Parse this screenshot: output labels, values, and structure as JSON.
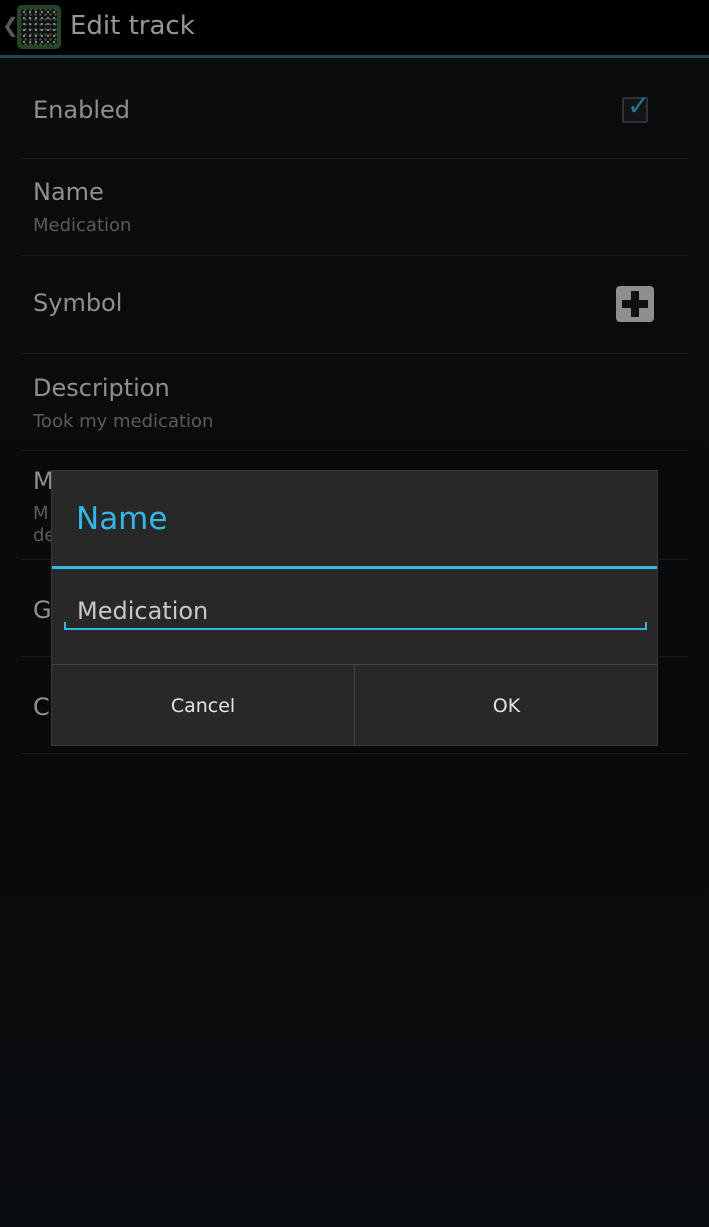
{
  "action_bar": {
    "title": "Edit track"
  },
  "prefs": {
    "enabled": {
      "label": "Enabled",
      "checked": true
    },
    "name": {
      "label": "Name",
      "summary": "Medication"
    },
    "symbol": {
      "label": "Symbol",
      "icon": "plus-icon"
    },
    "description": {
      "label": "Description",
      "summary": "Took my medication"
    },
    "partial1": {
      "label": "M",
      "summary": "M",
      "summary2": "de"
    },
    "partial2": {
      "label": "G"
    },
    "partial3": {
      "label": "C"
    }
  },
  "dialog": {
    "title": "Name",
    "input_value": "Medication",
    "cancel_label": "Cancel",
    "ok_label": "OK",
    "accent": "#33b5e5"
  }
}
